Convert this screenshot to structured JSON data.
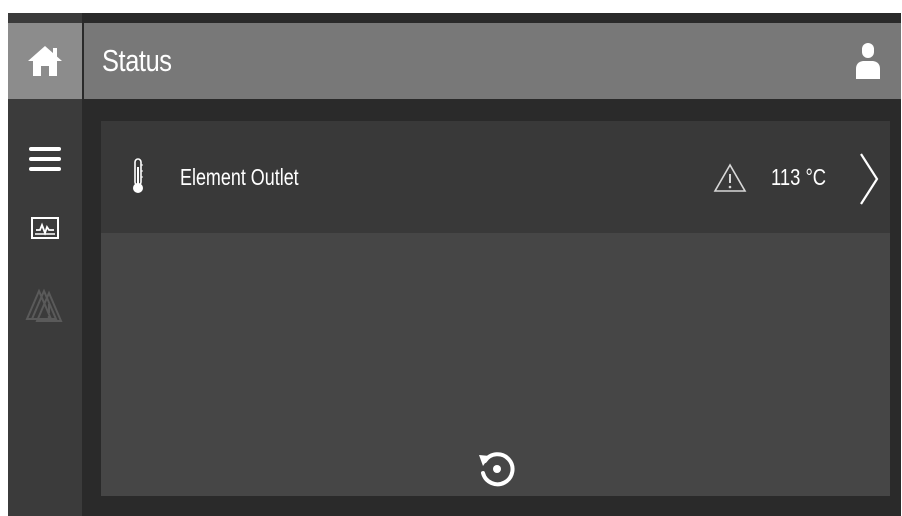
{
  "header": {
    "title": "Status"
  },
  "status_items": [
    {
      "label": "Element Outlet",
      "value": "113 °C",
      "has_warning": true
    }
  ],
  "icons": {
    "home": "home-icon",
    "menu": "hamburger-menu-icon",
    "trend": "trend-chart-icon",
    "alarms": "alarm-warning-icon",
    "user": "user-icon",
    "sensor": "thermometer-icon",
    "warning": "warning-triangle-icon",
    "detail": "chevron-right-icon",
    "refresh": "refresh-icon"
  },
  "colors": {
    "screen_bg": "#2a2a2a",
    "rail_bg": "#3b3b3b",
    "header_bg": "#787878",
    "home_bg": "#8c8c8c",
    "content_bg": "#464646",
    "row_bg": "#393939",
    "text": "#ffffff"
  }
}
